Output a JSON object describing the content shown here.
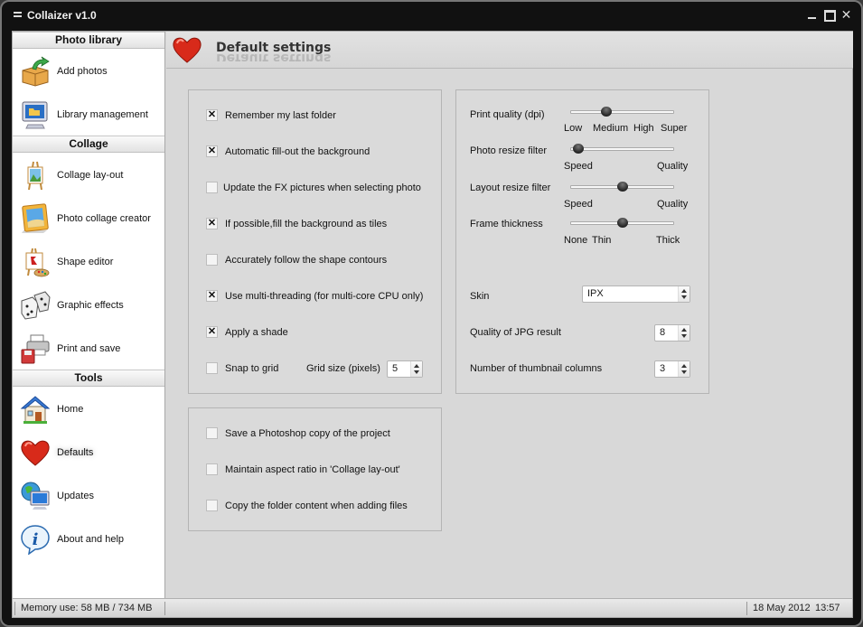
{
  "window": {
    "title": "Collaizer v1.0",
    "controls": [
      "minimize",
      "maximize",
      "close"
    ],
    "close_glyph": "✕"
  },
  "sidebar": {
    "sections": [
      {
        "header": "Photo library",
        "items": [
          {
            "label": "Add photos",
            "icon": "box-arrow-icon"
          },
          {
            "label": "Library management",
            "icon": "monitor-folder-icon"
          }
        ]
      },
      {
        "header": "Collage",
        "items": [
          {
            "label": "Collage lay-out",
            "icon": "easel-icon"
          },
          {
            "label": "Photo collage creator",
            "icon": "picture-frame-icon"
          },
          {
            "label": "Shape editor",
            "icon": "easel-palette-icon"
          },
          {
            "label": "Graphic effects",
            "icon": "dice-icon"
          },
          {
            "label": "Print and save",
            "icon": "printer-floppy-icon"
          }
        ]
      },
      {
        "header": "Tools",
        "items": [
          {
            "label": "Home",
            "icon": "house-icon"
          },
          {
            "label": "Defaults",
            "icon": "heart-icon",
            "active": true
          },
          {
            "label": "Updates",
            "icon": "globe-monitor-icon"
          },
          {
            "label": "About and help",
            "icon": "info-bubble-icon"
          }
        ]
      }
    ]
  },
  "main": {
    "title": "Default settings",
    "panel1": {
      "options": [
        {
          "label": "Remember my last folder",
          "checked": true
        },
        {
          "label": "Automatic fill-out the background",
          "checked": true
        },
        {
          "label": "Update the FX pictures when selecting photo",
          "checked": false
        },
        {
          "label": "If possible,fill the background as tiles",
          "checked": true
        },
        {
          "label": "Accurately follow the shape contours",
          "checked": false
        },
        {
          "label": "Use multi-threading (for multi-core CPU only)",
          "checked": true
        },
        {
          "label": "Apply a shade",
          "checked": true
        },
        {
          "label": "Snap to grid",
          "checked": false
        }
      ],
      "grid_size": {
        "label": "Grid size (pixels)",
        "value": "5"
      }
    },
    "panel2": {
      "sliders": [
        {
          "label": "Print quality (dpi)",
          "ticks": [
            "Low",
            "Medium",
            "High",
            "Super"
          ],
          "position": 0.33
        },
        {
          "label": "Photo resize filter",
          "ticks": [
            "Speed",
            "Quality"
          ],
          "position": 0.03
        },
        {
          "label": "Layout resize filter",
          "ticks": [
            "Speed",
            "Quality"
          ],
          "position": 0.5
        },
        {
          "label": "Frame thickness",
          "ticks": [
            "None",
            "Thin",
            "Thick"
          ],
          "position": 0.5
        }
      ],
      "skin": {
        "label": "Skin",
        "value": "IPX"
      },
      "jpg_quality": {
        "label": "Quality of JPG result",
        "value": "8"
      },
      "thumb_columns": {
        "label": "Number of thumbnail columns",
        "value": "3"
      }
    },
    "panel3": {
      "options": [
        {
          "label": "Save a Photoshop copy of the project",
          "checked": false
        },
        {
          "label": "Maintain aspect ratio in 'Collage lay-out'",
          "checked": false
        },
        {
          "label": "Copy the folder content when adding files",
          "checked": false
        }
      ]
    }
  },
  "status": {
    "memory": "Memory use: 58 MB / 734 MB",
    "date": "18 May 2012",
    "time": "13:57"
  }
}
